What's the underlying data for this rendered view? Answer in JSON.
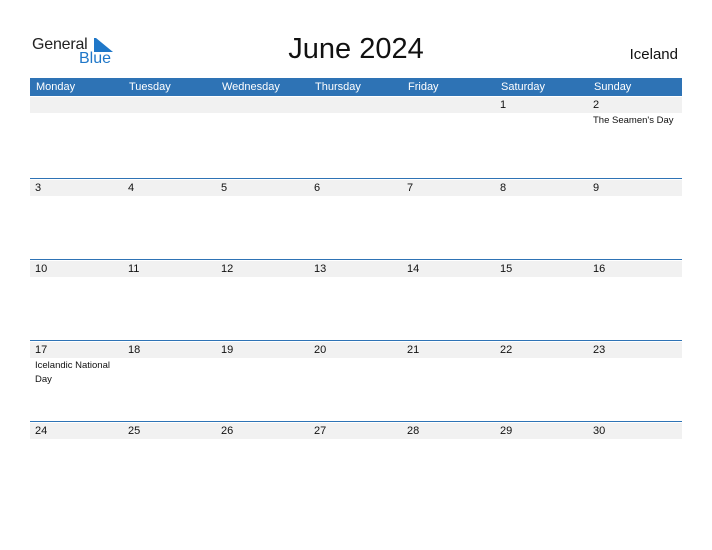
{
  "logo": {
    "general": "General",
    "blue": "Blue",
    "accent_color": "#1f77c8"
  },
  "title": "June 2024",
  "country": "Iceland",
  "theme": {
    "header_bg": "#2e73b5",
    "strip_bg": "#f1f1f1"
  },
  "days": [
    "Monday",
    "Tuesday",
    "Wednesday",
    "Thursday",
    "Friday",
    "Saturday",
    "Sunday"
  ],
  "weeks": [
    {
      "dates": [
        "",
        "",
        "",
        "",
        "",
        "1",
        "2"
      ],
      "holidays": [
        "",
        "",
        "",
        "",
        "",
        "",
        "The Seamen's Day"
      ]
    },
    {
      "dates": [
        "3",
        "4",
        "5",
        "6",
        "7",
        "8",
        "9"
      ],
      "holidays": [
        "",
        "",
        "",
        "",
        "",
        "",
        ""
      ]
    },
    {
      "dates": [
        "10",
        "11",
        "12",
        "13",
        "14",
        "15",
        "16"
      ],
      "holidays": [
        "",
        "",
        "",
        "",
        "",
        "",
        ""
      ]
    },
    {
      "dates": [
        "17",
        "18",
        "19",
        "20",
        "21",
        "22",
        "23"
      ],
      "holidays": [
        "Icelandic National Day",
        "",
        "",
        "",
        "",
        "",
        ""
      ]
    },
    {
      "dates": [
        "24",
        "25",
        "26",
        "27",
        "28",
        "29",
        "30"
      ],
      "holidays": [
        "",
        "",
        "",
        "",
        "",
        "",
        ""
      ]
    }
  ]
}
